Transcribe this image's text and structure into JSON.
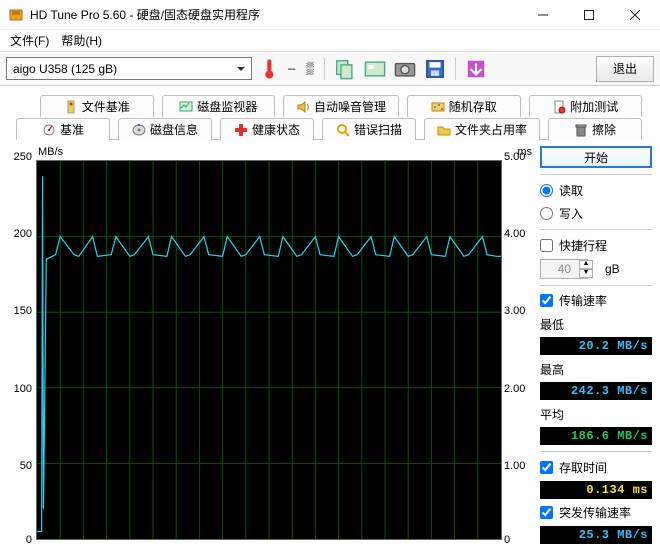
{
  "window": {
    "title": "HD Tune Pro 5.60 - 硬盘/固态硬盘实用程序"
  },
  "menu": {
    "file": "文件(F)",
    "help": "帮助(H)"
  },
  "toolbar": {
    "drive": "aigo   U358 (125 gB)",
    "exit": "退出"
  },
  "tabs_top": {
    "file_bench": "文件基准",
    "disk_monitor": "磁盘监视器",
    "auto_noise": "自动噪音管理",
    "random_access": "随机存取",
    "additional_test": "附加测试"
  },
  "tabs_bottom": {
    "benchmark": "基准",
    "disk_info": "磁盘信息",
    "health": "健康状态",
    "error_scan": "错误扫描",
    "folder_usage": "文件夹占用率",
    "erase": "擦除"
  },
  "side": {
    "start": "开始",
    "read": "读取",
    "write": "写入",
    "quick": "快捷行程",
    "size_val": "40",
    "size_unit": "gB",
    "transfer_rate": "传输速率",
    "min": "最低",
    "min_v": "20.2 MB/s",
    "max": "最高",
    "max_v": "242.3 MB/s",
    "avg": "平均",
    "avg_v": "186.6 MB/s",
    "access_time": "存取时间",
    "access_v": "0.134 ms",
    "burst_rate": "突发传输速率",
    "burst_v": "25.3 MB/s"
  },
  "chart_data": {
    "type": "line",
    "title": "",
    "xlabel": "",
    "ylabel": "MB/s",
    "y2label": "ms",
    "ylim": [
      0,
      250
    ],
    "y2lim": [
      0,
      5.0
    ],
    "y_ticks": [
      0,
      50,
      100,
      150,
      200,
      250
    ],
    "y2_ticks": [
      0,
      1.0,
      2.0,
      3.0,
      4.0,
      5.0
    ],
    "x_range_pct": [
      0,
      100
    ],
    "series": [
      {
        "name": "transfer-rate-mb-s",
        "axis": "left",
        "x_pct": [
          0,
          1,
          1.2,
          1.4,
          2,
          4,
          5,
          8,
          9,
          12,
          13,
          16,
          17,
          20,
          21,
          24,
          25,
          28,
          29,
          32,
          33,
          36,
          37,
          40,
          41,
          44,
          45,
          48,
          49,
          52,
          53,
          56,
          57,
          60,
          61,
          64,
          65,
          68,
          69,
          72,
          73,
          76,
          77,
          80,
          81,
          84,
          85,
          88,
          89,
          92,
          93,
          96,
          97,
          99,
          100
        ],
        "values": [
          5,
          5,
          240,
          20,
          185,
          188,
          200,
          188,
          187,
          200,
          187,
          188,
          200,
          187,
          188,
          200,
          188,
          187,
          200,
          187,
          188,
          200,
          188,
          187,
          200,
          187,
          188,
          200,
          188,
          187,
          200,
          187,
          188,
          200,
          188,
          187,
          200,
          187,
          188,
          200,
          188,
          187,
          200,
          187,
          188,
          200,
          188,
          187,
          200,
          187,
          188,
          200,
          188,
          187,
          187
        ]
      }
    ]
  }
}
